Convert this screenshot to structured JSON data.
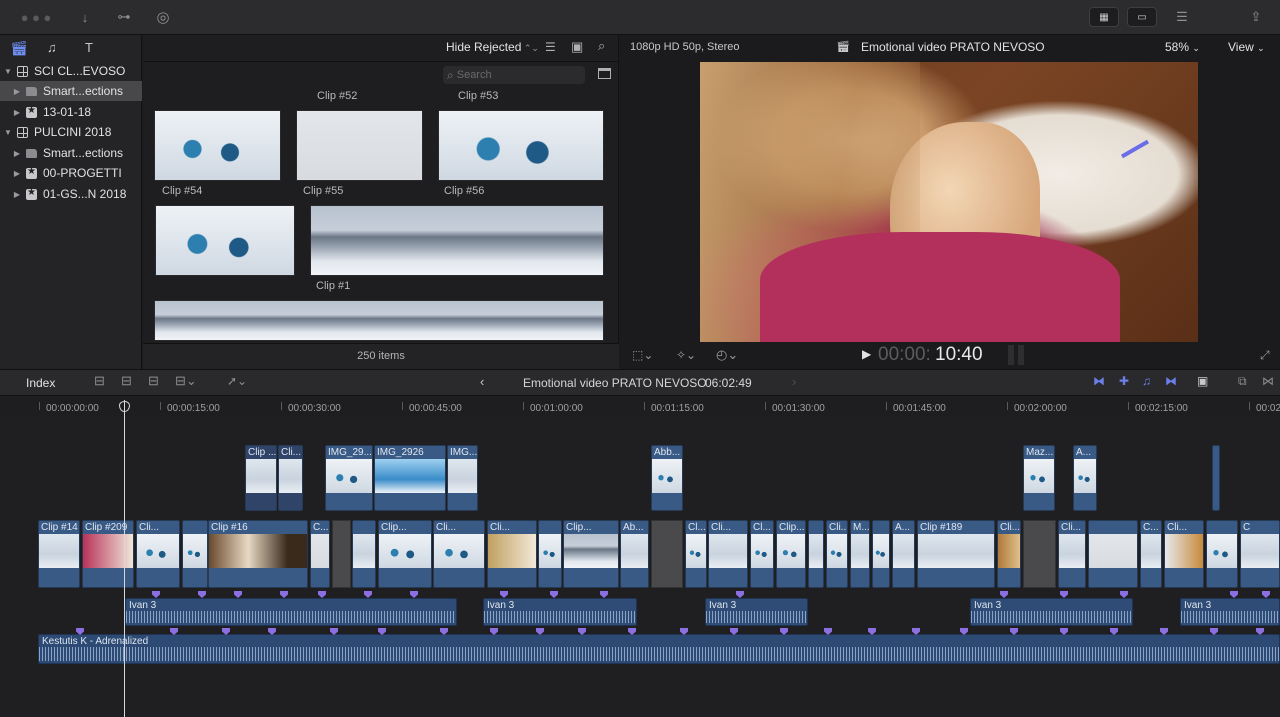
{
  "browser": {
    "filter": "Hide Rejected",
    "search_placeholder": "Search",
    "item_count": "250 items",
    "clip_labels": {
      "c52": "Clip #52",
      "c53": "Clip #53",
      "c54": "Clip #54",
      "c55": "Clip #55",
      "c56": "Clip #56",
      "c1": "Clip #1"
    }
  },
  "sidebar": {
    "items": [
      {
        "label": "SCI CL...EVOSO"
      },
      {
        "label": "Smart...ections"
      },
      {
        "label": "13-01-18"
      },
      {
        "label": "PULCINI 2018"
      },
      {
        "label": "Smart...ections"
      },
      {
        "label": "00-PROGETTI"
      },
      {
        "label": "01-GS...N 2018"
      }
    ]
  },
  "viewer": {
    "format": "1080p HD 50p, Stereo",
    "project": "Emotional video PRATO NEVOSO",
    "zoom": "58%",
    "view": "View",
    "timecode_dim": "00:00:",
    "timecode": "10:40"
  },
  "timeline": {
    "index": "Index",
    "project": "Emotional video PRATO NEVOSO",
    "duration": "06:02:49",
    "ruler": [
      "00:00:00:00",
      "00:00:15:00",
      "00:00:30:00",
      "00:00:45:00",
      "00:01:00:00",
      "00:01:15:00",
      "00:01:30:00",
      "00:01:45:00",
      "00:02:00:00",
      "00:02:15:00",
      "00:02"
    ],
    "connected": [
      "Clip ...",
      "Cli...",
      "IMG_29...",
      "IMG_2926",
      "IMG...",
      "Abb...",
      "Maz...",
      "A..."
    ],
    "primary": [
      "Clip #14",
      "Clip #209",
      "Cli...",
      "Clip #16",
      "C...",
      "Clip...",
      "Cli...",
      "Cli...",
      "Clip...",
      "Ab...",
      "Cl...",
      "Cli...",
      "Cl...",
      "Clip...",
      "Cli...",
      "M...",
      "A...",
      "Clip #189",
      "Cli...",
      "Cli...",
      "C...",
      "Cli...",
      "C"
    ],
    "audio": [
      "Ivan 3",
      "Ivan 3",
      "Ivan 3",
      "Ivan 3",
      "Ivan 3"
    ],
    "music": "Kestutis K - Adrenalized"
  }
}
